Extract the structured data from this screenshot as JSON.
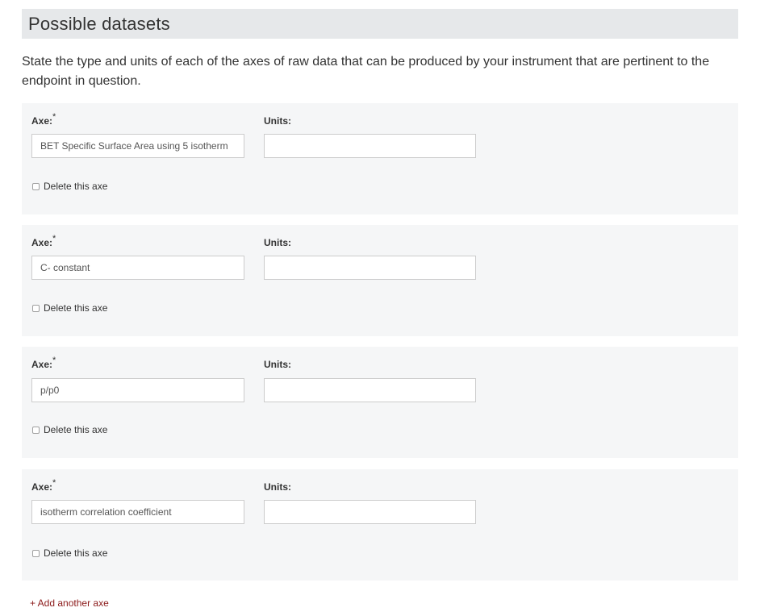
{
  "section": {
    "title": "Possible datasets",
    "description": "State the type and units of each of the axes of raw data that can be produced by your instrument that are pertinent to the endpoint in question."
  },
  "labels": {
    "axe": "Axe:",
    "required_marker": "*",
    "units": "Units:",
    "delete": "Delete this axe"
  },
  "axes": [
    {
      "axe_value": "BET Specific Surface Area using 5 isotherm",
      "units_value": "",
      "delete_checked": false
    },
    {
      "axe_value": "C- constant",
      "units_value": "",
      "delete_checked": false
    },
    {
      "axe_value": "p/p0",
      "units_value": "",
      "delete_checked": false
    },
    {
      "axe_value": "isotherm correlation coefficient",
      "units_value": "",
      "delete_checked": false
    }
  ],
  "add_link_label": "+ Add another axe",
  "colors": {
    "header_bg": "#e6e8ea",
    "panel_bg": "#f5f6f7",
    "link": "#8b1a1a"
  }
}
